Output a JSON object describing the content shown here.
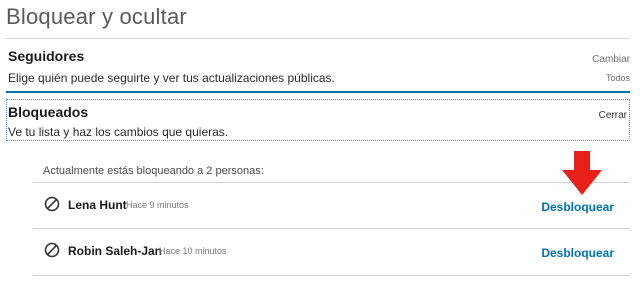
{
  "page_title": "Bloquear y ocultar",
  "followers": {
    "heading": "Seguidores",
    "description": "Elige quién puede seguirte y ver tus actualizaciones públicas.",
    "change_label": "Cambiar",
    "current_value": "Todos"
  },
  "blocked": {
    "heading": "Bloqueados",
    "description": "Ve tu lista y haz los cambios que quieras.",
    "close_label": "Cerrar",
    "count_text": "Actualmente estás bloqueando a 2 personas:",
    "people": [
      {
        "name": "Lena Hunt",
        "time": "Hace 9 minutos",
        "action": "Desbloquear",
        "icon": "block-icon"
      },
      {
        "name": "Robin Saleh-Jan",
        "time": "Hace 10 minutos",
        "action": "Desbloquear",
        "icon": "block-icon"
      }
    ]
  },
  "colors": {
    "accent": "#0073b1",
    "annotation_arrow": "#e8201a"
  }
}
